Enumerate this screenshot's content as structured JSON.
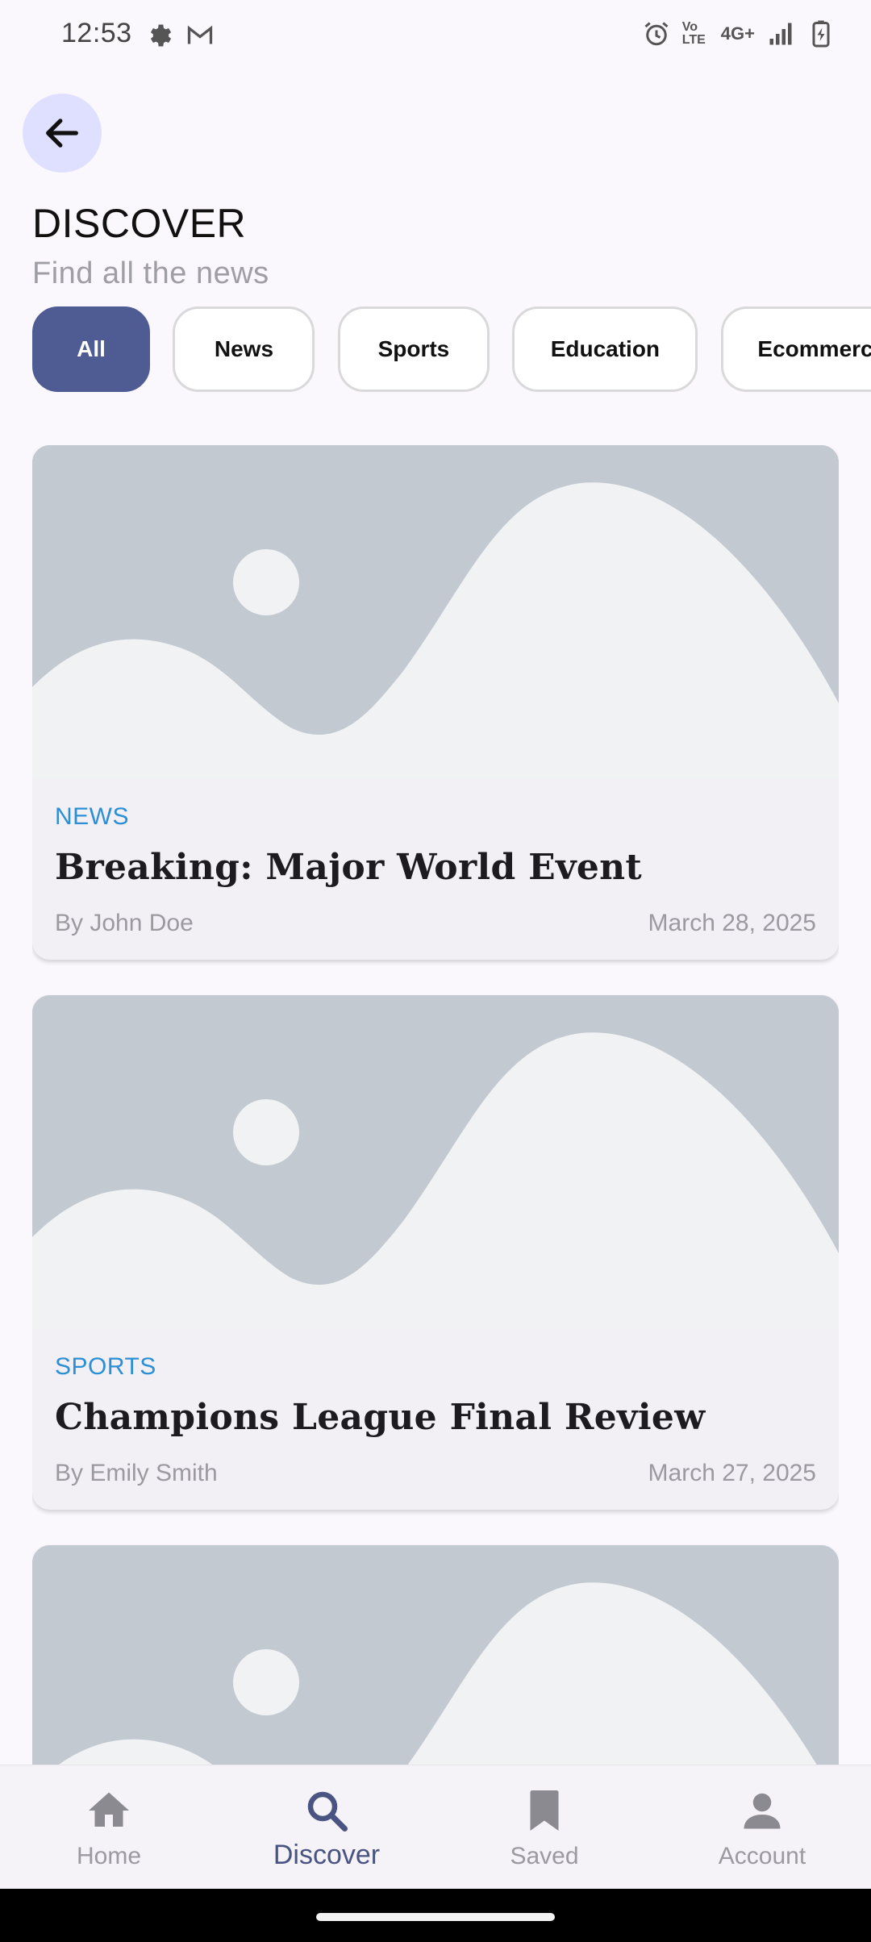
{
  "status_bar": {
    "time": "12:53",
    "left_icons": [
      "settings-gear-icon",
      "gmail-icon"
    ],
    "right_icons": [
      "alarm-icon",
      "volte-icon",
      "network-4g-icon",
      "signal-icon",
      "battery-charging-icon"
    ],
    "network_label": "4G+",
    "volte_label": "Vo LTE"
  },
  "header": {
    "back_icon": "arrow-left-icon",
    "title": "DISCOVER",
    "subtitle": "Find all the news"
  },
  "categories": [
    {
      "label": "All",
      "active": true
    },
    {
      "label": "News",
      "active": false
    },
    {
      "label": "Sports",
      "active": false
    },
    {
      "label": "Education",
      "active": false
    },
    {
      "label": "Ecommerce",
      "active": false
    }
  ],
  "articles": [
    {
      "category": "NEWS",
      "title": "Breaking: Major World Event",
      "author": "By John Doe",
      "date": "March 28, 2025"
    },
    {
      "category": "SPORTS",
      "title": "Champions League Final Review",
      "author": "By Emily Smith",
      "date": "March 27, 2025"
    },
    {
      "category": "",
      "title": "",
      "author": "",
      "date": ""
    }
  ],
  "bottom_nav": [
    {
      "label": "Home",
      "icon": "home-icon",
      "active": false
    },
    {
      "label": "Discover",
      "icon": "search-icon",
      "active": true
    },
    {
      "label": "Saved",
      "icon": "bookmark-icon",
      "active": false
    },
    {
      "label": "Account",
      "icon": "person-icon",
      "active": false
    }
  ],
  "colors": {
    "background": "#fbf8fd",
    "accent": "#4f5b93",
    "back_button_bg": "#dfe0ff",
    "category_text": "#2b8fd6",
    "placeholder_bg": "#c2c9d1",
    "placeholder_fg": "#f1f2f3"
  }
}
